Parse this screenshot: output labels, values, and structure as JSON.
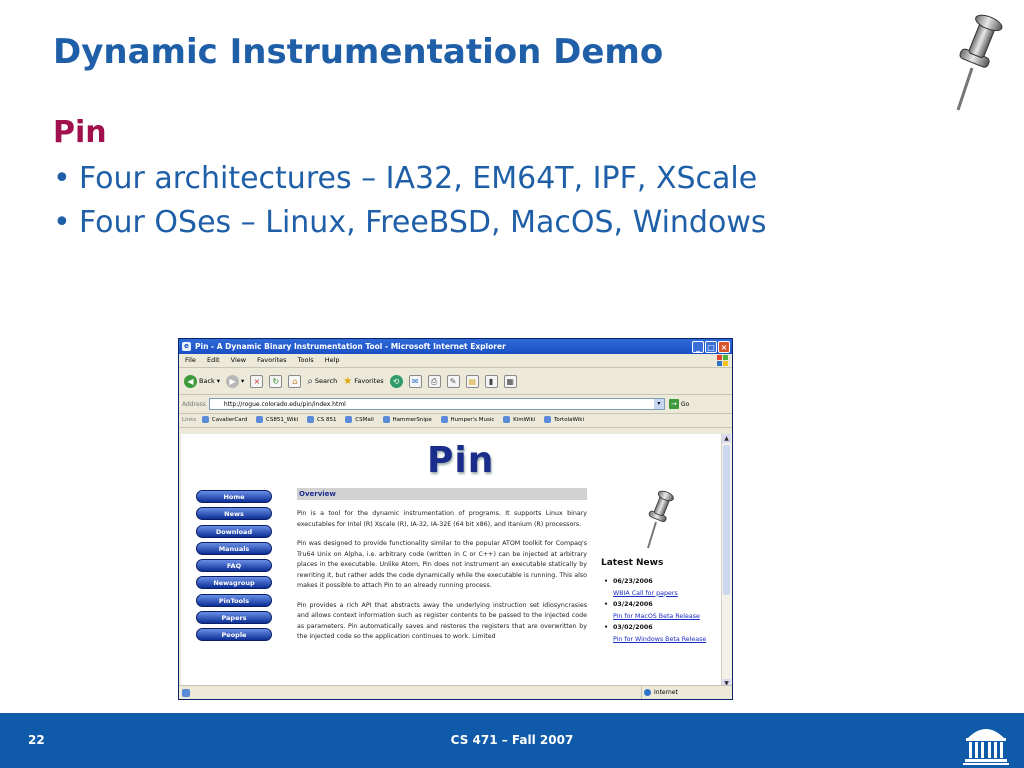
{
  "slide": {
    "title": "Dynamic Instrumentation Demo",
    "subheading": "Pin",
    "bullets": [
      "Four architectures – IA32, EM64T, IPF, XScale",
      "Four OSes – Linux, FreeBSD, MacOS, Windows"
    ],
    "bullet_glyph": "•"
  },
  "browser": {
    "title": "Pin - A Dynamic Binary Instrumentation Tool - Microsoft Internet Explorer",
    "menu": [
      "File",
      "Edit",
      "View",
      "Favorites",
      "Tools",
      "Help"
    ],
    "toolbar": {
      "back": "Back",
      "search": "Search",
      "favorites": "Favorites"
    },
    "address": {
      "label": "Address",
      "url": "http://rogue.colorado.edu/pin/index.html",
      "go": "Go"
    },
    "links": {
      "label": "Links",
      "items": [
        "CavalierCard",
        "CS851_Wiki",
        "CS 851",
        "CSMail",
        "HammerSnipe",
        "Humper's Music",
        "KimWiki",
        "TortolaWiki"
      ]
    },
    "status": {
      "zone": "Internet"
    }
  },
  "page": {
    "logo": "Pin",
    "nav": [
      "Home",
      "News",
      "Download",
      "Manuals",
      "FAQ",
      "Newsgroup",
      "PinTools",
      "Papers",
      "People"
    ],
    "overview": {
      "heading": "Overview",
      "paragraphs": [
        "Pin is a tool for the dynamic instrumentation of programs. It supports Linux binary executables for Intel (R) Xscale (R), IA-32, IA-32E (64 bit x86), and Itanium (R) processors.",
        "Pin was designed to provide functionality similar to the popular ATOM toolkit for Compaq's Tru64 Unix on Alpha, i.e. arbitrary code (written in C or C++) can be injected at arbitrary places in the executable. Unlike Atom, Pin does not instrument an executable statically by rewriting it, but rather adds the code dynamically while the executable is running. This also makes it possible to attach Pin to an already running process.",
        "Pin provides a rich API that abstracts away the underlying instruction set idiosyncrasies and allows context information such as register contents to be passed to the injected code as parameters. Pin automatically saves and restores the registers that are overwritten by the injected code so the application continues to work. Limited"
      ]
    },
    "news": {
      "title": "Latest News",
      "items": [
        {
          "date": "06/23/2006",
          "link": "WBIA Call for papers"
        },
        {
          "date": "03/24/2006",
          "link": "Pin for MacOS Beta Release"
        },
        {
          "date": "03/02/2006",
          "link": "Pin for Windows Beta Release"
        }
      ]
    }
  },
  "footer": {
    "page_number": "22",
    "course": "CS 471 – Fall 2007"
  },
  "colors": {
    "title_blue": "#1f5fa8",
    "subhead_magenta": "#a0104d",
    "footer_blue": "#0f5ba9"
  },
  "icons": [
    "pushpin-icon",
    "rotunda-logo-icon",
    "ie-back-icon",
    "ie-forward-icon",
    "ie-stop-icon",
    "ie-refresh-icon",
    "ie-home-icon",
    "ie-search-icon",
    "ie-favorites-icon",
    "ie-history-icon",
    "ie-mail-icon",
    "ie-print-icon",
    "ie-go-icon"
  ]
}
